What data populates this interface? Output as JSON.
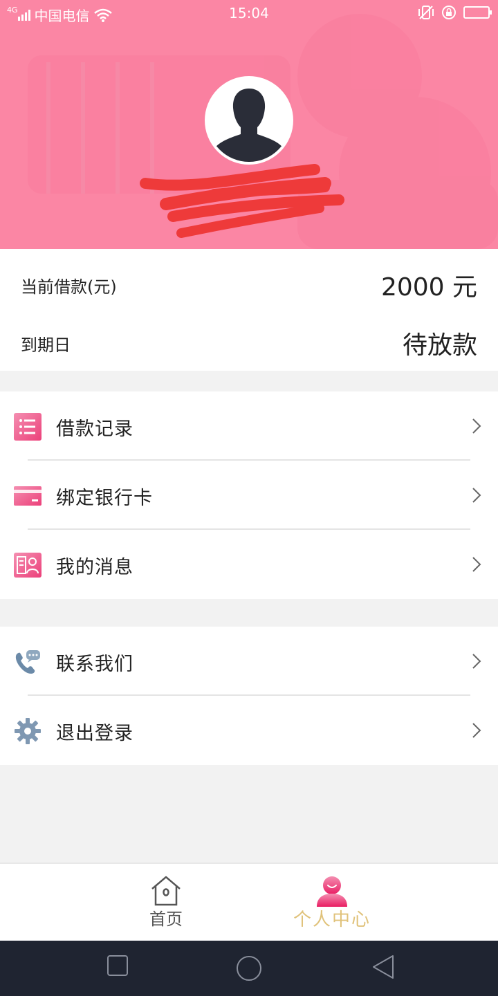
{
  "status_bar": {
    "network_type": "4G",
    "carrier": "中国电信",
    "time": "15:04"
  },
  "colors": {
    "header_pink": "#fb86a4",
    "accent_pink": "#f06292",
    "active_tab_text": "#e0c27a",
    "redaction_red": "#ee3a3a",
    "nav_bar": "#1f2431"
  },
  "profile": {
    "avatar_icon": "default-user-avatar"
  },
  "loan": {
    "current_label": "当前借款(元)",
    "current_value": "2000 元",
    "due_label": "到期日",
    "due_value": "待放款"
  },
  "menu_group_1": [
    {
      "label": "借款记录",
      "icon": "list-icon"
    },
    {
      "label": "绑定银行卡",
      "icon": "bank-card-icon"
    },
    {
      "label": "我的消息",
      "icon": "message-icon"
    }
  ],
  "menu_group_2": [
    {
      "label": "联系我们",
      "icon": "phone-chat-icon"
    },
    {
      "label": "退出登录",
      "icon": "gear-icon"
    }
  ],
  "tabbar": {
    "home_label": "首页",
    "me_label": "个人中心",
    "active": "个人中心"
  }
}
